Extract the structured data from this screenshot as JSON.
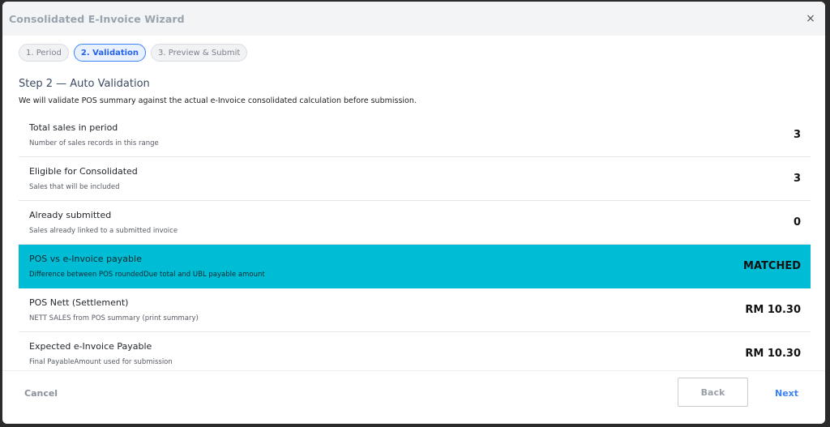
{
  "header": {
    "title": "Consolidated E-Invoice Wizard",
    "close_icon": "×"
  },
  "steps": [
    {
      "label": "1. Period",
      "active": false
    },
    {
      "label": "2. Validation",
      "active": true
    },
    {
      "label": "3. Preview & Submit",
      "active": false
    }
  ],
  "section": {
    "title": "Step 2 — Auto Validation",
    "description": "We will validate POS summary against the actual e-Invoice consolidated calculation before submission."
  },
  "rows": [
    {
      "label": "Total sales in period",
      "sub": "Number of sales records in this range",
      "value": "3"
    },
    {
      "label": "Eligible for Consolidated",
      "sub": "Sales that will be included",
      "value": "3"
    },
    {
      "label": "Already submitted",
      "sub": "Sales already linked to a submitted invoice",
      "value": "0"
    },
    {
      "label": "POS vs e-Invoice payable",
      "sub": "Difference between POS roundedDue total and UBL payable amount",
      "value": "MATCHED"
    },
    {
      "label": "POS Nett (Settlement)",
      "sub": "NETT SALES from POS summary (print summary)",
      "value": "RM 10.30"
    },
    {
      "label": "Expected e-Invoice Payable",
      "sub": "Final PayableAmount used for submission",
      "value": "RM 10.30"
    }
  ],
  "colors": {
    "highlight": "#00bcd4",
    "accent": "#3b82f6"
  },
  "footer": {
    "cancel_label": "Cancel",
    "back_label": "Back",
    "next_label": "Next"
  }
}
